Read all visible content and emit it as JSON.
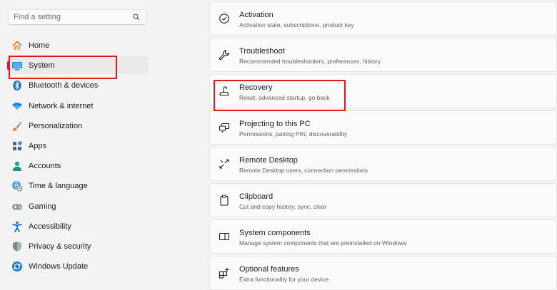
{
  "search": {
    "placeholder": "Find a setting"
  },
  "sidebar": {
    "items": [
      {
        "label": "Home",
        "icon": "home-icon"
      },
      {
        "label": "System",
        "icon": "system-icon",
        "selected": true
      },
      {
        "label": "Bluetooth & devices",
        "icon": "bluetooth-icon"
      },
      {
        "label": "Network & internet",
        "icon": "wifi-icon"
      },
      {
        "label": "Personalization",
        "icon": "brush-icon"
      },
      {
        "label": "Apps",
        "icon": "apps-icon"
      },
      {
        "label": "Accounts",
        "icon": "account-icon"
      },
      {
        "label": "Time & language",
        "icon": "globe-clock-icon"
      },
      {
        "label": "Gaming",
        "icon": "gamepad-icon"
      },
      {
        "label": "Accessibility",
        "icon": "accessibility-icon"
      },
      {
        "label": "Privacy & security",
        "icon": "shield-icon"
      },
      {
        "label": "Windows Update",
        "icon": "update-icon"
      }
    ]
  },
  "settings": [
    {
      "title": "Activation",
      "subtitle": "Activation state, subscriptions, product key",
      "icon": "check-circle-icon"
    },
    {
      "title": "Troubleshoot",
      "subtitle": "Recommended troubleshooters, preferences, history",
      "icon": "wrench-icon"
    },
    {
      "title": "Recovery",
      "subtitle": "Reset, advanced startup, go back",
      "icon": "recovery-icon"
    },
    {
      "title": "Projecting to this PC",
      "subtitle": "Permissions, pairing PIN, discoverability",
      "icon": "projecting-icon"
    },
    {
      "title": "Remote Desktop",
      "subtitle": "Remote Desktop users, connection permissions",
      "icon": "remote-desktop-icon"
    },
    {
      "title": "Clipboard",
      "subtitle": "Cut and copy history, sync, clear",
      "icon": "clipboard-icon"
    },
    {
      "title": "System components",
      "subtitle": "Manage system components that are preinstalled on Windows",
      "icon": "system-components-icon"
    },
    {
      "title": "Optional features",
      "subtitle": "Extra functionality for your device",
      "icon": "optional-features-icon"
    }
  ],
  "colors": {
    "accent": "#a6267f",
    "highlight": "#e3161b",
    "icon_blue": "#0f6cbd"
  }
}
